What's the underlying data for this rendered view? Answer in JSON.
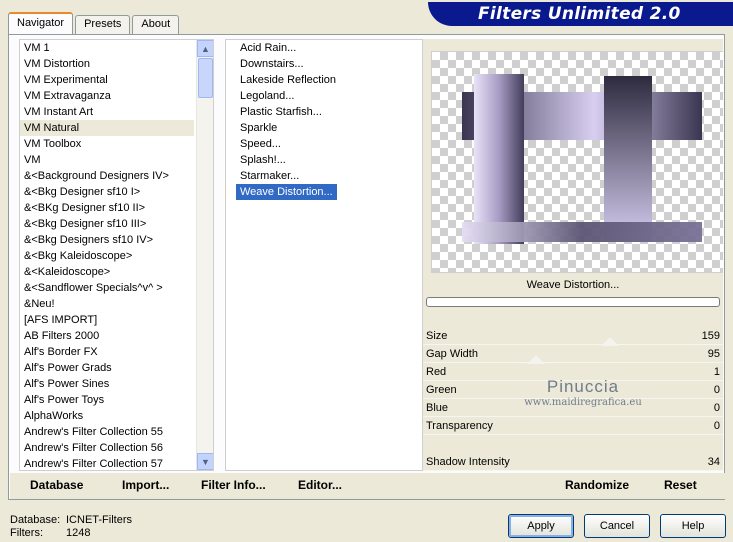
{
  "tabs": [
    {
      "label": "Navigator",
      "active": true
    },
    {
      "label": "Presets",
      "active": false
    },
    {
      "label": "About",
      "active": false
    }
  ],
  "banner": {
    "title": "Filters Unlimited 2.0",
    "color": "#0a1a8e"
  },
  "categories": [
    "VM 1",
    "VM Distortion",
    "VM Experimental",
    "VM Extravaganza",
    "VM Instant Art",
    "VM Natural",
    "VM Toolbox",
    "VM",
    "&<Background Designers IV>",
    "&<Bkg Designer sf10 I>",
    "&<BKg Designer sf10 II>",
    "&<Bkg Designer sf10 III>",
    "&<Bkg Designers sf10 IV>",
    "&<Bkg Kaleidoscope>",
    "&<Kaleidoscope>",
    "&<Sandflower Specials^v^ >",
    "&Neu!",
    "[AFS IMPORT]",
    "AB Filters 2000",
    "Alf's Border FX",
    "Alf's Power Grads",
    "Alf's Power Sines",
    "Alf's Power Toys",
    "AlphaWorks",
    "Andrew's Filter Collection 55",
    "Andrew's Filter Collection 56",
    "Andrew's Filter Collection 57"
  ],
  "selected_category": "VM Natural",
  "filters": [
    "Acid Rain...",
    "Downstairs...",
    "Lakeside Reflection",
    "Legoland...",
    "Plastic Starfish...",
    "Sparkle",
    "Speed...",
    "Splash!...",
    "Starmaker...",
    "Weave Distortion..."
  ],
  "selected_filter": "Weave Distortion...",
  "preview": {
    "filter_name": "Weave Distortion..."
  },
  "parameters": [
    {
      "label": "Size",
      "value": "159"
    },
    {
      "label": "Gap Width",
      "value": "95"
    },
    {
      "label": "Red",
      "value": "1"
    },
    {
      "label": "Green",
      "value": "0"
    },
    {
      "label": "Blue",
      "value": "0"
    },
    {
      "label": "Transparency",
      "value": "0"
    },
    {
      "label": "Shadow Intensity",
      "value": "34"
    }
  ],
  "watermark": {
    "line1": "Pinuccia",
    "line2": "www.maidiregrafica.eu"
  },
  "bottom_buttons": {
    "database": "Database",
    "import": "Import...",
    "filter_info": "Filter Info...",
    "editor": "Editor...",
    "randomize": "Randomize",
    "reset": "Reset"
  },
  "status": {
    "database_label": "Database:",
    "database_value": "ICNET-Filters",
    "filters_label": "Filters:",
    "filters_value": "1248"
  },
  "dialog_buttons": {
    "apply": "Apply",
    "cancel": "Cancel",
    "help": "Help"
  }
}
